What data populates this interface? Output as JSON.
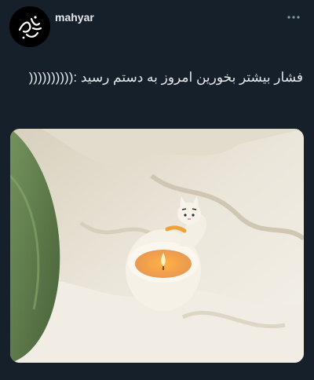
{
  "tweet": {
    "username": "mahyar",
    "text": "فشار بیشتر بخورین امروز به دستم رسید :((((((((((",
    "media_icon": "cat-candle-photo"
  },
  "icons": {
    "more": "more-dots-icon",
    "avatar_logo": "calligraphy-logo"
  },
  "colors": {
    "background": "#15202b",
    "text": "#e7e9ea",
    "icon_muted": "#8899a6"
  }
}
